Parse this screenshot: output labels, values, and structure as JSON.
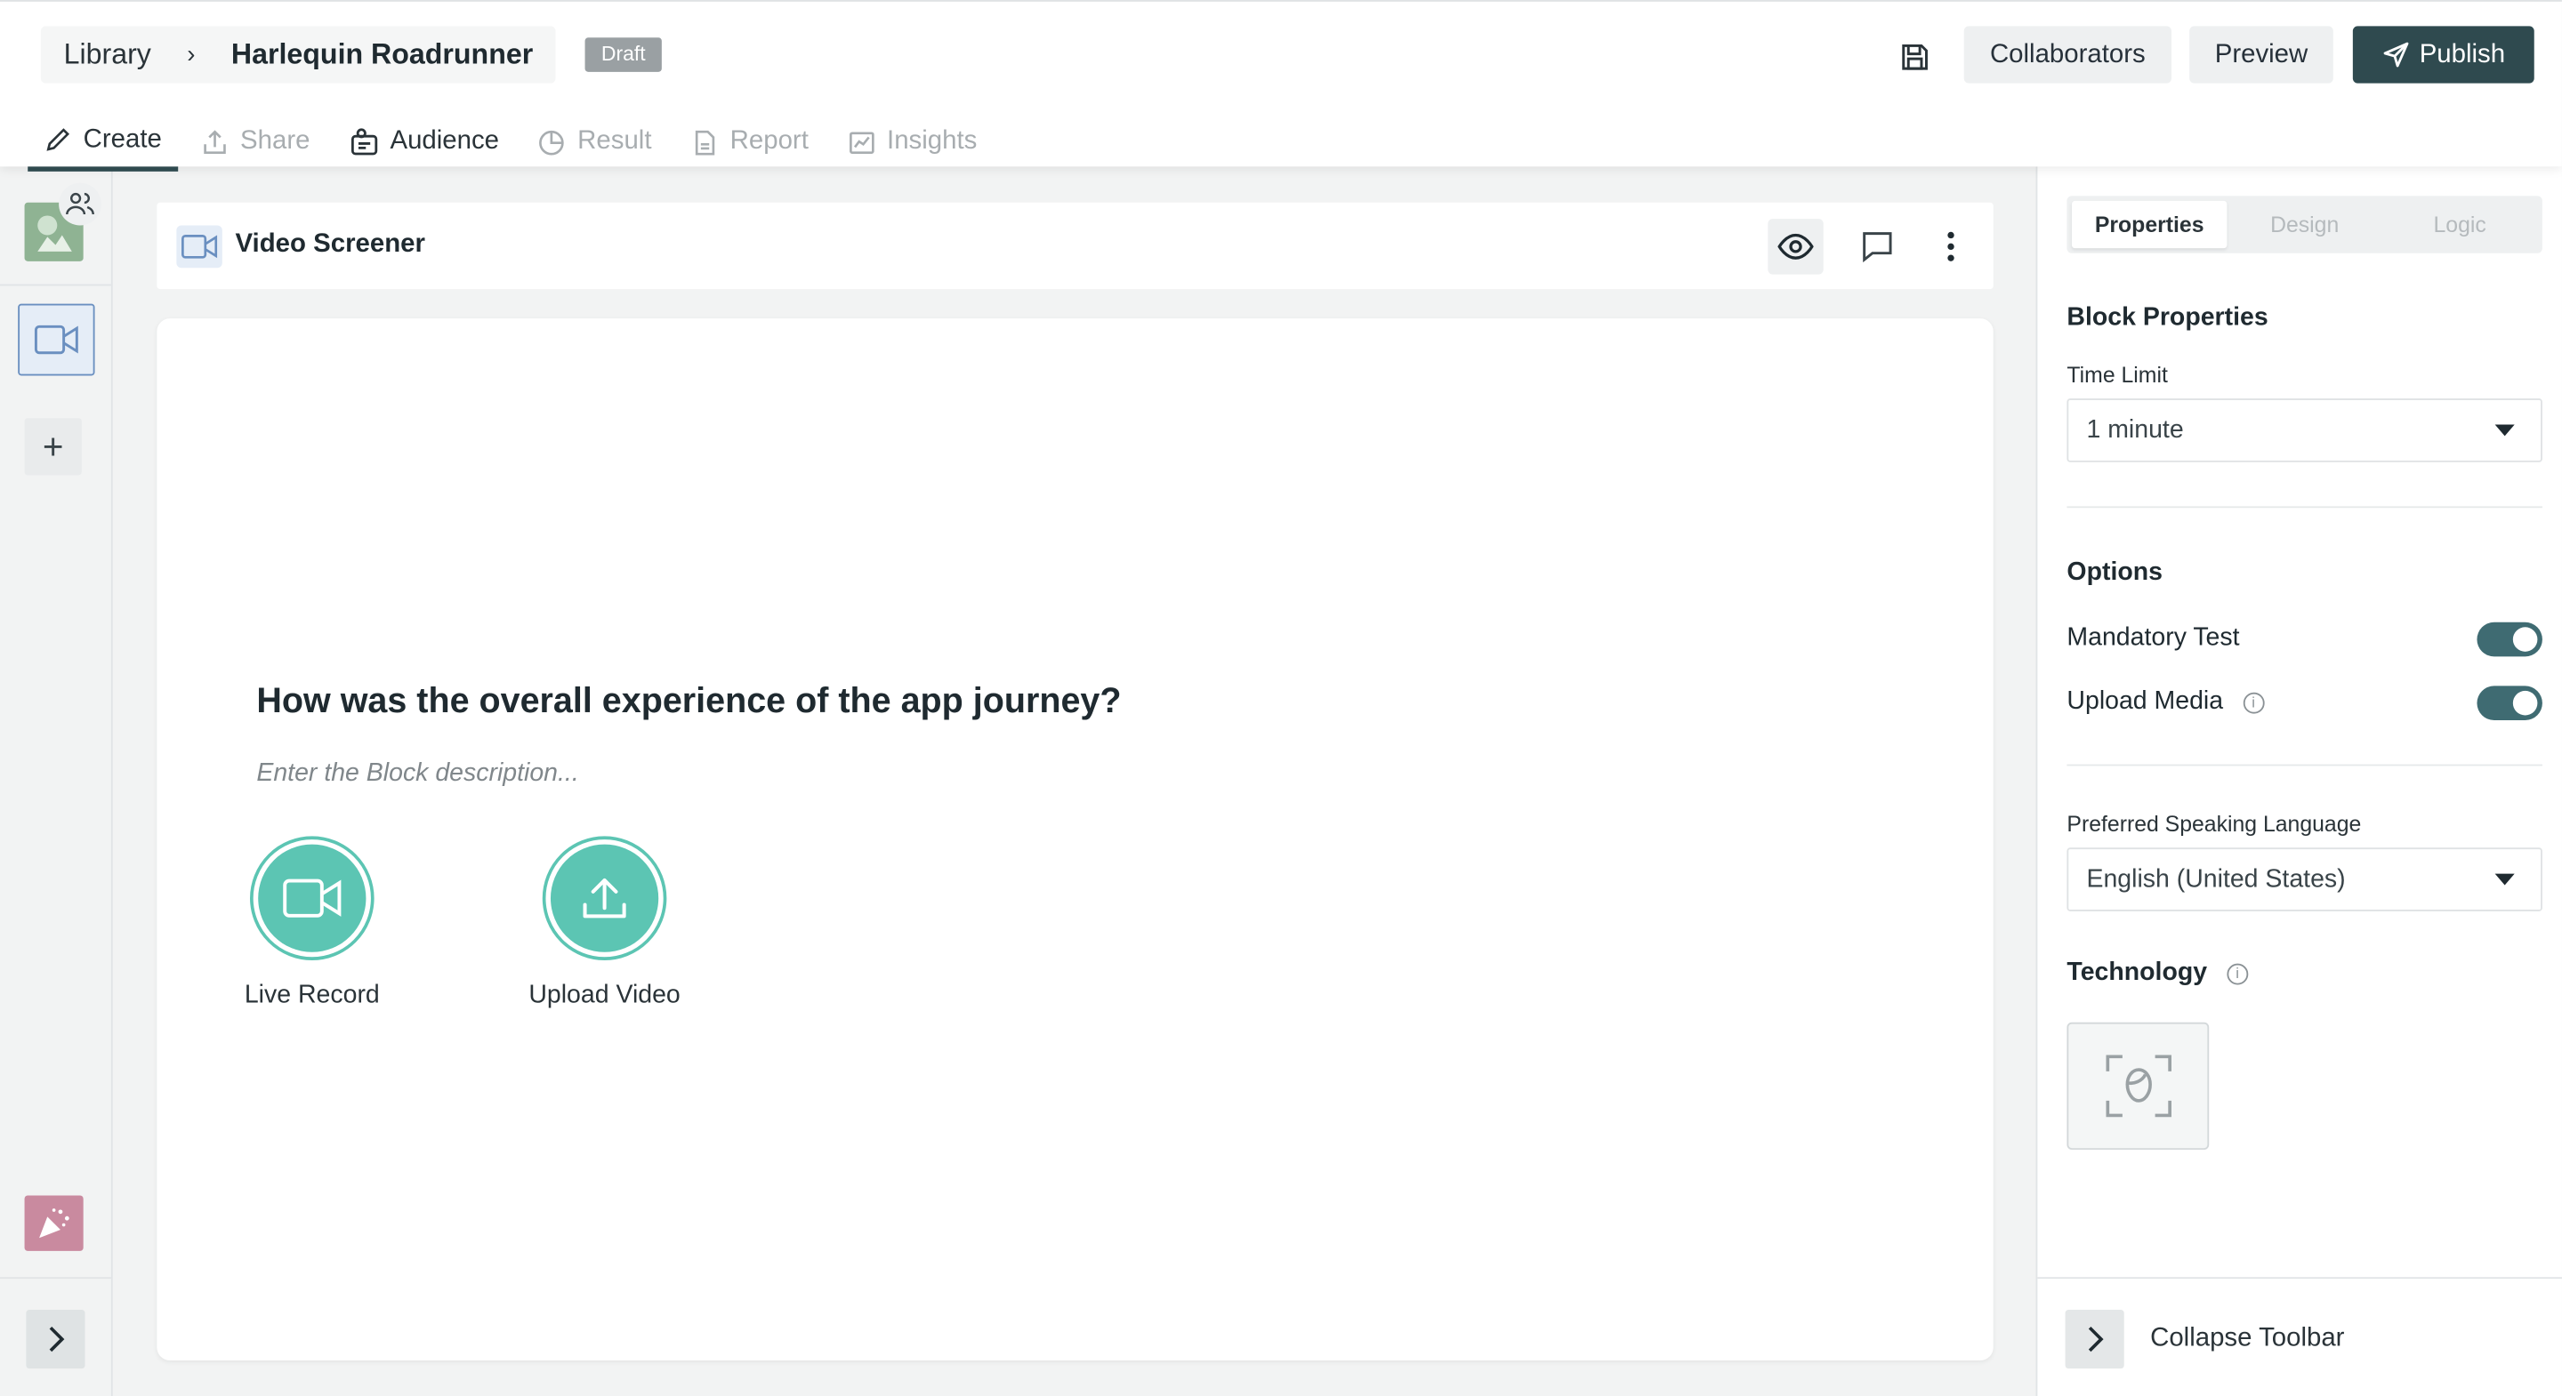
{
  "header": {
    "breadcrumb_root": "Library",
    "breadcrumb_sep": "›",
    "title": "Harlequin Roadrunner",
    "status_badge": "Draft",
    "collaborators_label": "Collaborators",
    "preview_label": "Preview",
    "publish_label": "Publish"
  },
  "tabs": [
    {
      "label": "Create",
      "icon": "pencil-icon",
      "state": "active"
    },
    {
      "label": "Share",
      "icon": "share-icon",
      "state": "disabled"
    },
    {
      "label": "Audience",
      "icon": "audience-icon",
      "state": "enabled"
    },
    {
      "label": "Result",
      "icon": "pie-chart-icon",
      "state": "disabled"
    },
    {
      "label": "Report",
      "icon": "report-icon",
      "state": "disabled"
    },
    {
      "label": "Insights",
      "icon": "insights-icon",
      "state": "disabled"
    }
  ],
  "block": {
    "type_label": "Video Screener",
    "question": "How was the overall experience of the app journey?",
    "description_placeholder": "Enter the Block description...",
    "options": [
      {
        "label": "Live Record",
        "icon": "video-camera-icon"
      },
      {
        "label": "Upload Video",
        "icon": "upload-icon"
      }
    ]
  },
  "panel": {
    "tabs": [
      "Properties",
      "Design",
      "Logic"
    ],
    "active_tab": "Properties",
    "block_properties_heading": "Block Properties",
    "time_limit_label": "Time Limit",
    "time_limit_value": "1 minute",
    "options_heading": "Options",
    "mandatory_test_label": "Mandatory Test",
    "mandatory_test_on": true,
    "upload_media_label": "Upload Media",
    "upload_media_on": true,
    "language_label": "Preferred Speaking Language",
    "language_value": "English (United States)",
    "technology_heading": "Technology",
    "technology_icon": "face-scan-icon",
    "collapse_label": "Collapse Toolbar"
  },
  "colors": {
    "primary_dark": "#2f4a4f",
    "accent_teal": "#5cc5b3",
    "toggle_on": "#3f6b72",
    "video_blue": "#6a8fc0"
  }
}
